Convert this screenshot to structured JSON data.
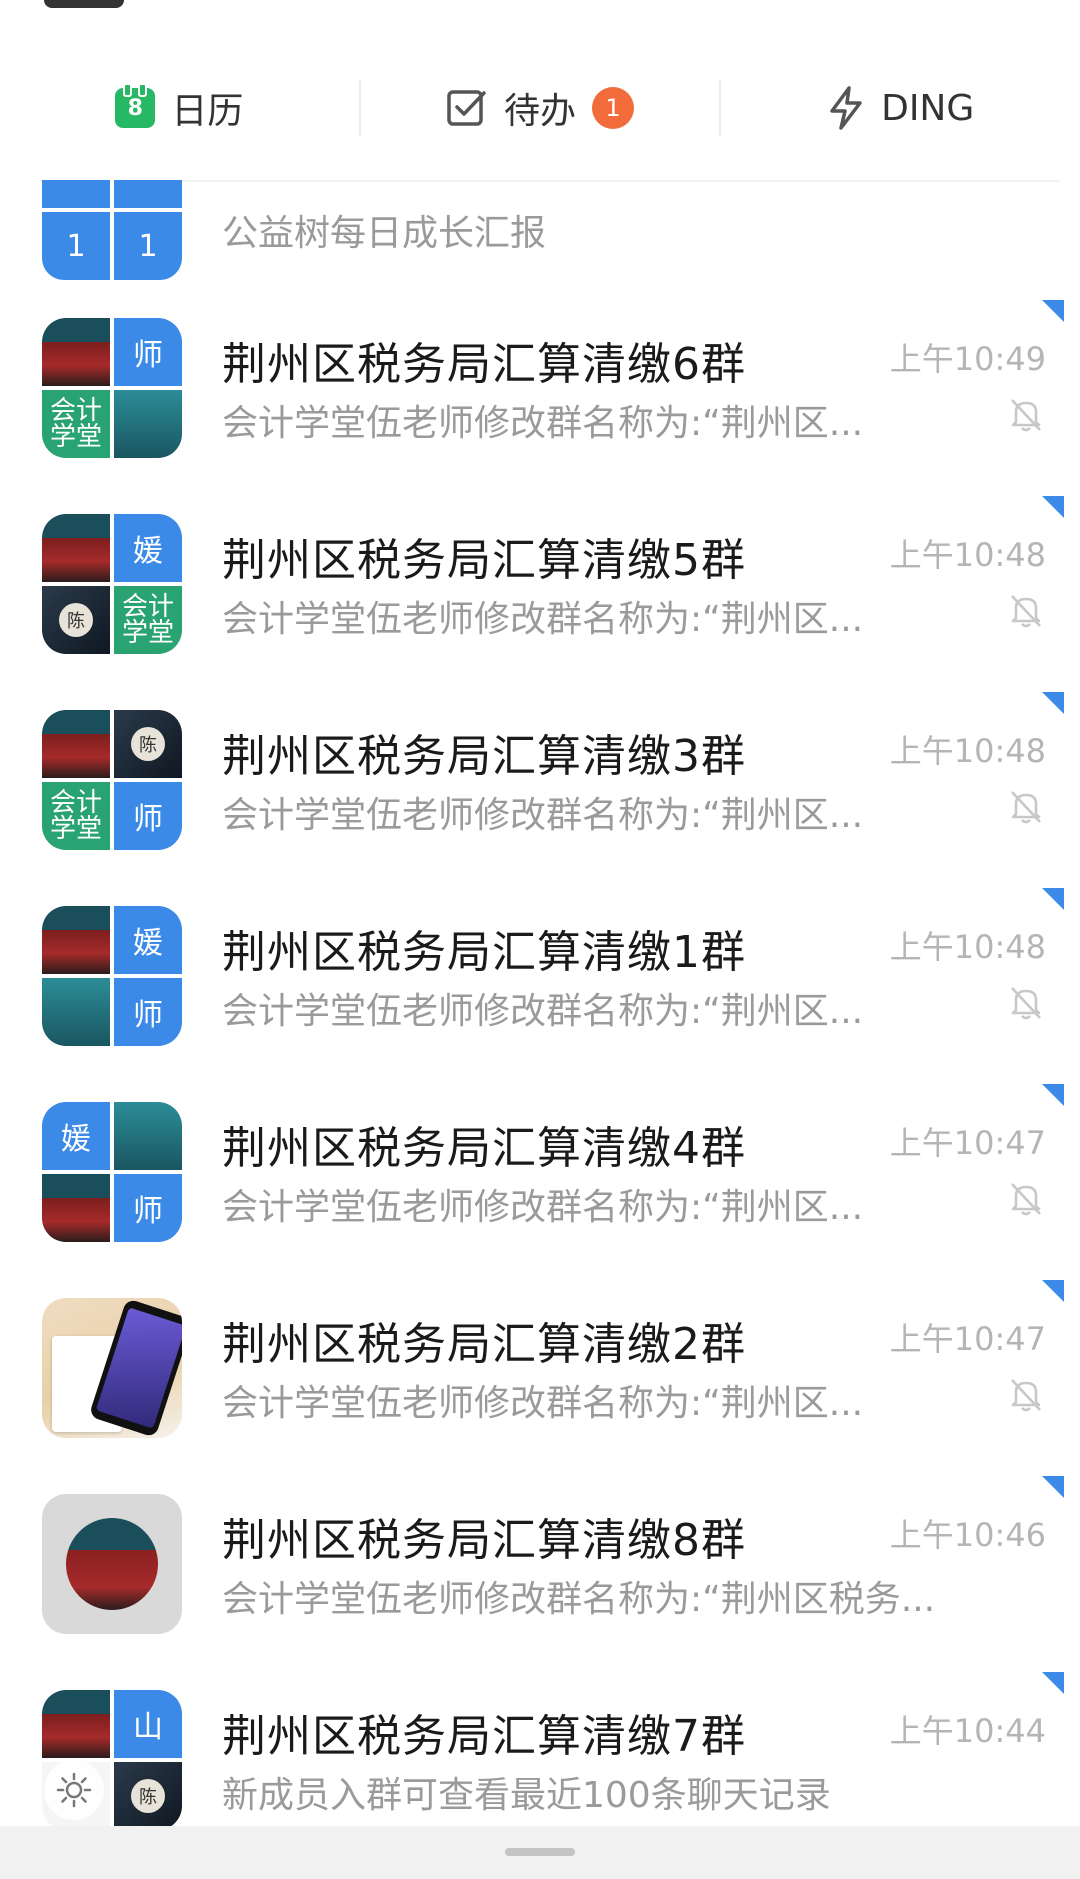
{
  "quick_bar": {
    "calendar": {
      "day": "8",
      "label": "日历"
    },
    "todo": {
      "label": "待办",
      "badge": "1"
    },
    "ding": {
      "label": "DING"
    }
  },
  "partial_row": {
    "avatar_cells": [
      "",
      "",
      "1",
      "1"
    ],
    "preview": "公益树每日成长汇报"
  },
  "chats": [
    {
      "title": "荆州区税务局汇算清缴6群",
      "time": "上午10:49",
      "preview": "会计学堂伍老师修改群名称为:“荆州区...",
      "muted": true,
      "avatar_labels": [
        "师",
        "会计学堂"
      ]
    },
    {
      "title": "荆州区税务局汇算清缴5群",
      "time": "上午10:48",
      "preview": "会计学堂伍老师修改群名称为:“荆州区...",
      "muted": true,
      "avatar_labels": [
        "媛",
        "陈",
        "会计学堂"
      ]
    },
    {
      "title": "荆州区税务局汇算清缴3群",
      "time": "上午10:48",
      "preview": "会计学堂伍老师修改群名称为:“荆州区...",
      "muted": true,
      "avatar_labels": [
        "陈",
        "会计学堂",
        "师"
      ]
    },
    {
      "title": "荆州区税务局汇算清缴1群",
      "time": "上午10:48",
      "preview": "会计学堂伍老师修改群名称为:“荆州区...",
      "muted": true,
      "avatar_labels": [
        "媛",
        "师"
      ]
    },
    {
      "title": "荆州区税务局汇算清缴4群",
      "time": "上午10:47",
      "preview": "会计学堂伍老师修改群名称为:“荆州区...",
      "muted": true,
      "avatar_labels": [
        "媛",
        "师"
      ]
    },
    {
      "title": "荆州区税务局汇算清缴2群",
      "time": "上午10:47",
      "preview": "会计学堂伍老师修改群名称为:“荆州区...",
      "muted": true,
      "avatar_labels": []
    },
    {
      "title": "荆州区税务局汇算清缴8群",
      "time": "上午10:46",
      "preview": "会计学堂伍老师修改群名称为:“荆州区税务...",
      "muted": false,
      "avatar_labels": []
    },
    {
      "title": "荆州区税务局汇算清缴7群",
      "time": "上午10:44",
      "preview": "新成员入群可查看最近100条聊天记录",
      "muted": false,
      "avatar_labels": [
        "山",
        "陈"
      ]
    }
  ],
  "colors": {
    "accent": "#3c8ae8",
    "badge": "#f26b3a",
    "calendar": "#27b865",
    "muted_text": "#9a9a9a",
    "time_text": "#b5b5b5"
  }
}
